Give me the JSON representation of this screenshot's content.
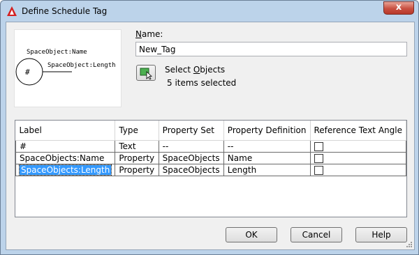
{
  "window": {
    "title": "Define Schedule Tag",
    "close_symbol": "x"
  },
  "preview": {
    "label_top": "SpaceObject:Name",
    "label_right": "SpaceObject:Length",
    "symbol": "#"
  },
  "name_field": {
    "label_prefix": "N",
    "label_rest": "ame:",
    "value": "New_Tag"
  },
  "select_objects": {
    "label_prefix": "Select ",
    "label_underlined": "O",
    "label_rest": "bjects",
    "status": "5 items selected"
  },
  "table": {
    "columns": [
      "Label",
      "Type",
      "Property Set",
      "Property Definition",
      "Reference Text Angle"
    ],
    "rows": [
      {
        "label": "#",
        "type": "Text",
        "property_set": "--",
        "property_definition": "--",
        "reference_text_angle": false
      },
      {
        "label": "SpaceObjects:Name",
        "type": "Property",
        "property_set": "SpaceObjects",
        "property_definition": "Name",
        "reference_text_angle": false
      },
      {
        "label": "SpaceObjects:Length",
        "type": "Property",
        "property_set": "SpaceObjects",
        "property_definition": "Length",
        "reference_text_angle": false
      }
    ]
  },
  "buttons": {
    "ok": "OK",
    "cancel": "Cancel",
    "help": "Help"
  },
  "colors": {
    "title_bar": "#bcd3ea",
    "selection": "#3399ff",
    "close_button": "#c85041"
  }
}
